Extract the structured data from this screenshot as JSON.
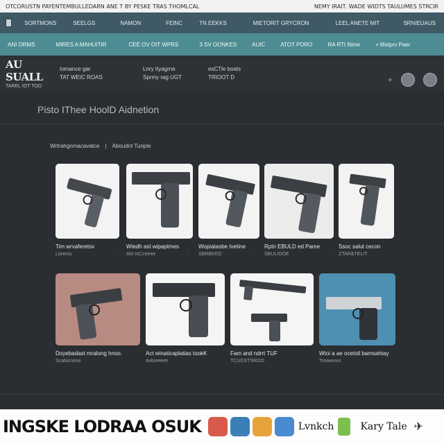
{
  "top_strip": {
    "left": "OTCORUSTN PAYENTEMBULLEDARN ANE T BY PESKE TRAS THOMLCAL",
    "right": "NEMY IRAIT. WADE WIDTS TAULUMES STRCIR"
  },
  "nav_primary": [
    "SORTMONS",
    "SEELGS",
    "NAMON",
    "FEINC",
    "TN EEKKS",
    "MIETORIT GRYCRON",
    "LEEL ANETE MIT",
    "SRNIEUAUS"
  ],
  "nav_secondary": [
    "ANI ORMS",
    "MIRES A MAHUITIR",
    "CEE OV OIT WPRS",
    "3 SV OONKES",
    "AUIC",
    "ATOT PORO",
    "RA RTI Nime",
    "+ Metprv Paer"
  ],
  "header": {
    "brand_title": "AU SUALL",
    "brand_sub": "TAREL IOT TOO",
    "col1_l1": "Iomance gar",
    "col1_l2": "TAT WEIC ROAS",
    "col2_l1": "Lnry Ityagrne",
    "col2_l2": "Sprmy rag UGT",
    "col3_l1": "esCTle boats",
    "col3_l2": "TRIOOT D"
  },
  "page_title": "Pisto IThee HoolD Aidnetion",
  "breadcrumb": [
    "Wrtrahgnmacavatce",
    "|",
    "Aboudnt Tunple"
  ],
  "cards_row1": [
    {
      "title": "Tim wrvaferetsv",
      "sub": "Lorerss",
      "sub_right": "·",
      "accent": "#f3f3f3"
    },
    {
      "title": "Wiedh ast wipaptmes",
      "sub": "Aht tsCcetree",
      "sub_right": "·",
      "accent": "#f3f3f3"
    },
    {
      "title": "Wopiatasbe Ivetine",
      "sub": "SBRBKED",
      "sub_right": "·",
      "accent": "#f3f3f3"
    },
    {
      "title": "Rptn EBULD ed Pame",
      "sub": "SBULIDOE",
      "sub_right": "·",
      "accent": "#efefef"
    },
    {
      "title": "Ssoc salut cecon",
      "sub": "ZTAR&TELIT",
      "sub_right": "",
      "accent": "#f3f3f3"
    }
  ],
  "cards_row2": [
    {
      "title": "Doyebadast mralong hnoo.",
      "sub": "Scabicnone",
      "sub_right": "",
      "accent": "#b78a82"
    },
    {
      "title": "Act winaticaplatias tookK",
      "sub": "Avbreeeet",
      "sub_right": "",
      "accent": "#f5f5f5"
    },
    {
      "title": "Fam and ndrrt TUF",
      "sub": "TCUDSTSROO",
      "sub_right": "",
      "accent": "#f5f5f5"
    },
    {
      "title": "Wtoi a ae ocetstl bamsahtay",
      "sub": "Treaveoor",
      "sub_right": "",
      "accent": "#4e90b2"
    }
  ],
  "footer": {
    "big_text": "INGSKE LODRAA OSUK",
    "tag1": "Lvnkch",
    "tag2": "Kary Tale"
  },
  "colors": {
    "nav_primary_bg": "#3f5965",
    "nav_secondary_bg": "#4d8c92",
    "page_bg": "#2a2d31"
  }
}
